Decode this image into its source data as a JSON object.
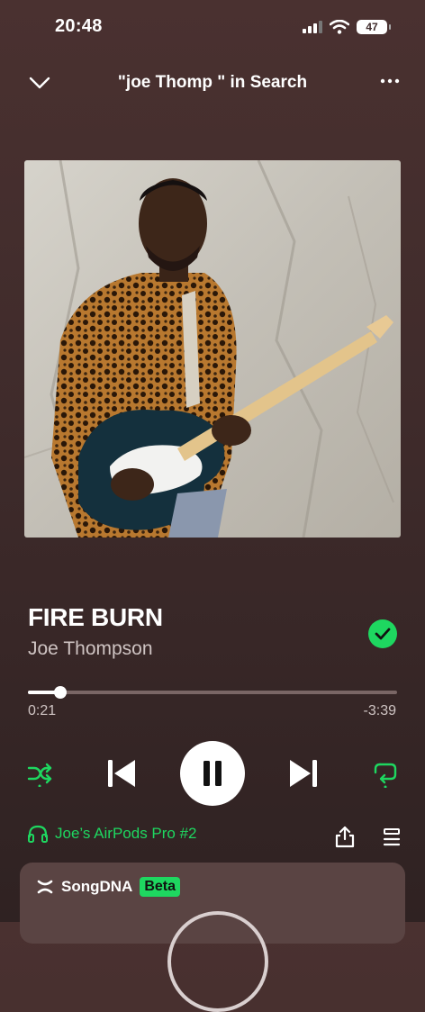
{
  "status_bar": {
    "time": "20:48",
    "battery": "47",
    "icons": [
      "signal-icon",
      "wifi-icon",
      "battery-icon"
    ]
  },
  "header": {
    "title": "\"joe Thomp \" in Search",
    "left_icon": "chevron-down-icon",
    "right_icon": "more-icon"
  },
  "track": {
    "title": "FIRE BURN",
    "artist": "Joe Thompson",
    "liked": true
  },
  "progress": {
    "elapsed": "0:21",
    "remaining": "-3:39",
    "fraction": 0.087
  },
  "controls": {
    "shuffle": "shuffle-icon",
    "previous": "skip-back-icon",
    "state": "playing",
    "next": "skip-forward-icon",
    "repeat": "repeat-icon"
  },
  "device": {
    "name": "Joe’s AirPods Pro #2"
  },
  "card": {
    "brand": "SongDNA",
    "badge": "Beta"
  },
  "colors": {
    "accent": "#1ed760",
    "background": "#3f2b2b"
  }
}
